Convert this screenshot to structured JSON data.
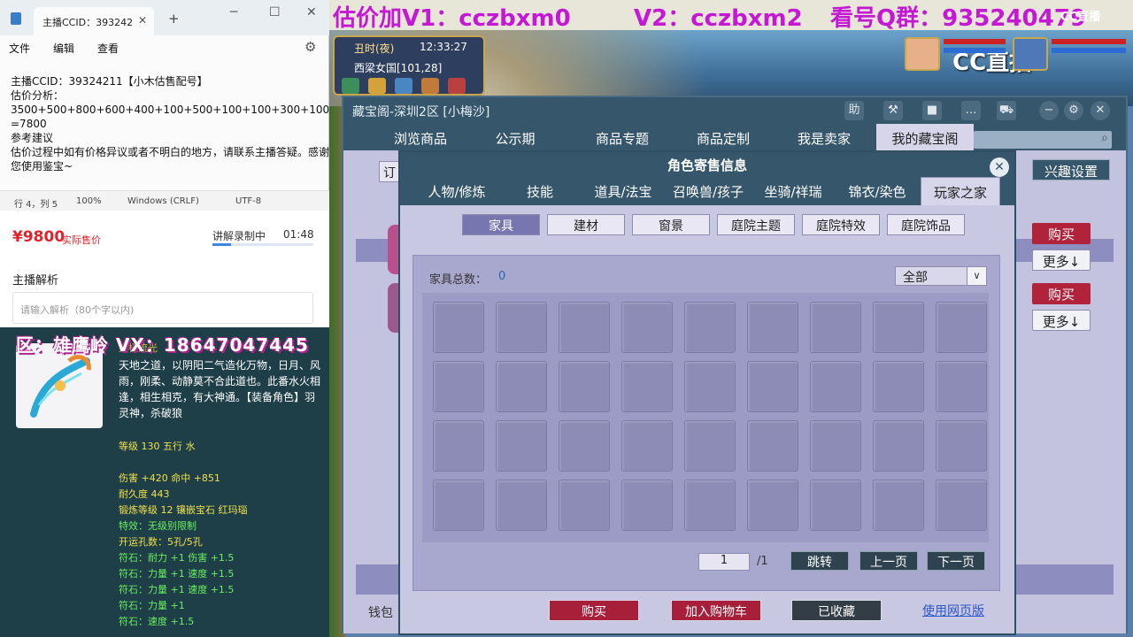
{
  "notepad": {
    "tab_title": "主播CCID：393242",
    "menu": [
      "文件",
      "编辑",
      "查看"
    ],
    "content": "主播CCID：39324211【小木估售配号】\n估价分析：\n3500+500+800+600+400+100+500+100+100+300+100+800\n=7800\n参考建议\n估价过程中如有价格异议或者不明白的地方，请联系主播答疑。感谢您使用鉴宝~",
    "status": {
      "position": "行 4，列 5",
      "zoom": "100%",
      "line_ending": "Windows (CRLF)",
      "encoding": "UTF-8"
    }
  },
  "price_panel": {
    "price": "¥9800",
    "price_tag": "实际售价",
    "recording_label": "讲解录制中",
    "recording_time": "01:48",
    "recording_progress": 0.18,
    "analysis_title": "主播解析",
    "analysis_placeholder": "请输入解析（80个字以内)"
  },
  "item": {
    "banner": "区：雄鹰岭 VX：18647047445",
    "name": "太极流光",
    "desc": "天地之道，以阴阳二气造化万物，日月、风雨，刚柔、动静莫不合此道也。此番水火相逢，相生相克，有大神通。【装备角色】羽灵神，杀破狼",
    "stats": [
      {
        "text": "等级 130 五行 水",
        "color": "yellow"
      },
      {
        "text": "",
        "color": "white"
      },
      {
        "text": "伤害 +420 命中 +851",
        "color": "yellow"
      },
      {
        "text": "耐久度 443",
        "color": "yellow"
      },
      {
        "text": "锻炼等级 12 镶嵌宝石 红玛瑙",
        "color": "yellow"
      },
      {
        "text": "特效：无级别限制",
        "color": "green"
      },
      {
        "text": "开运孔数：5孔/5孔",
        "color": "yellow"
      },
      {
        "text": "符石：耐力 +1 伤害 +1.5",
        "color": "green"
      },
      {
        "text": "符石：力量 +1 速度 +1.5",
        "color": "green"
      },
      {
        "text": "符石：力量 +1 速度 +1.5",
        "color": "green"
      },
      {
        "text": "符石：力量 +1",
        "color": "green"
      },
      {
        "text": "符石：速度 +1.5",
        "color": "green"
      }
    ]
  },
  "stream_overlay": {
    "banner_v1": "估价加V1：cczbxm0",
    "banner_v2": "V2：cczbxm2",
    "banner_qq": "看号Q群：935240479",
    "cc_logo": "CC直播",
    "cc_small": "CC直播"
  },
  "hud": {
    "time_of_day": "丑时(夜)",
    "clock": "12:33:27",
    "location": "西梁女国[101,28]"
  },
  "treasure_window": {
    "title": "藏宝阁-深圳2区 [小梅沙]",
    "tabs": [
      "浏览商品",
      "公示期",
      "商品专题",
      "商品定制",
      "我是卖家",
      "我的藏宝阁"
    ],
    "active_tab": 5,
    "order_label": "订",
    "interest_label": "兴趣设置",
    "buy_label": "购买",
    "more_label": "更多↓",
    "wallet_label": "钱包"
  },
  "dialog": {
    "title": "角色寄售信息",
    "tabs": [
      "人物/修炼",
      "技能",
      "道具/法宝",
      "召唤兽/孩子",
      "坐骑/祥瑞",
      "锦衣/染色",
      "玩家之家"
    ],
    "active_tab": 6,
    "subtabs": [
      "家具",
      "建材",
      "窗景",
      "庭院主题",
      "庭院特效",
      "庭院饰品"
    ],
    "active_subtab": 0,
    "count_label": "家具总数：",
    "count_value": "0",
    "filter_value": "全部",
    "page_current": "1",
    "page_total": "/1",
    "jump_label": "跳转",
    "prev_label": "上一页",
    "next_label": "下一页",
    "buy_label": "购买",
    "cart_label": "加入购物车",
    "fav_label": "已收藏",
    "web_label": "使用网页版"
  }
}
